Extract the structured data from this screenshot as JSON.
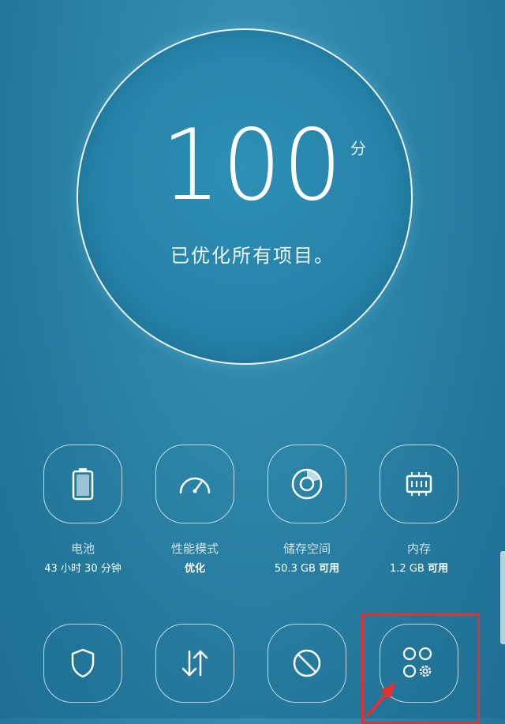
{
  "score": {
    "value": "100",
    "unit": "分",
    "status": "已优化所有项目。"
  },
  "tiles": [
    {
      "label": "电池",
      "sub_value": "43 小时 30 分钟",
      "sub_bold": "",
      "icon": "battery-icon"
    },
    {
      "label": "性能模式",
      "sub_value": "",
      "sub_bold": "优化",
      "icon": "speedometer-icon"
    },
    {
      "label": "储存空间",
      "sub_value": "50.3 GB ",
      "sub_bold": "可用",
      "icon": "storage-disc-icon"
    },
    {
      "label": "内存",
      "sub_value": "1.2 GB ",
      "sub_bold": "可用",
      "icon": "memory-chip-icon"
    },
    {
      "icon": "shield-icon"
    },
    {
      "icon": "data-transfer-arrows-icon"
    },
    {
      "icon": "block-icon"
    },
    {
      "icon": "apps-settings-icon"
    }
  ],
  "colors": {
    "background": "#2a82a5",
    "highlight": "#e13131"
  }
}
